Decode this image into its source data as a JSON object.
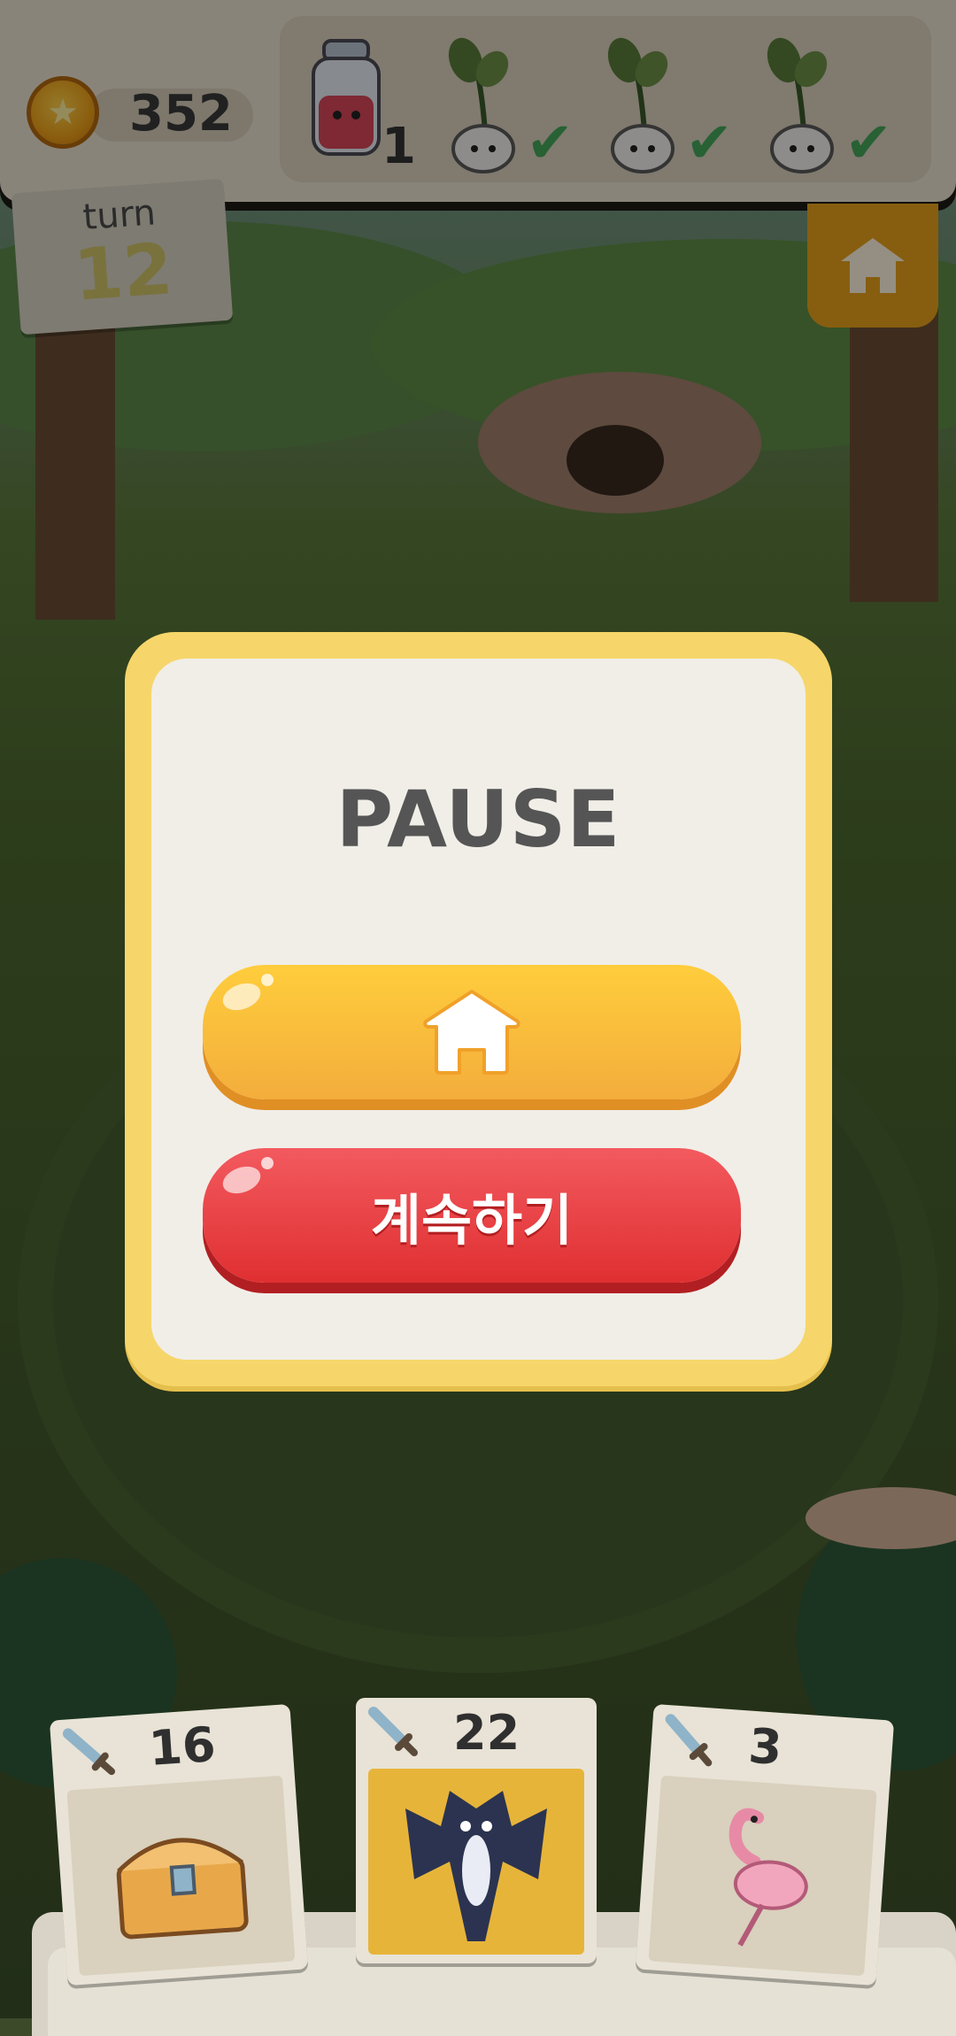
{
  "hud": {
    "coins": "352",
    "goals": [
      {
        "icon": "potion-jar-icon",
        "count": "1",
        "completed": false
      },
      {
        "icon": "sprout-radish-icon",
        "completed": true
      },
      {
        "icon": "sprout-radish-icon",
        "completed": true
      },
      {
        "icon": "sprout-radish-icon",
        "completed": true
      }
    ],
    "turn_label": "turn",
    "turn_number": "12"
  },
  "pause_menu": {
    "title": "PAUSE",
    "home_button_icon": "house-icon",
    "continue_label": "계속하기"
  },
  "hand_cards": [
    {
      "attack": "16",
      "art": "treasure-chest-icon"
    },
    {
      "attack": "22",
      "art": "bat-icon"
    },
    {
      "attack": "3",
      "art": "flamingo-icon"
    }
  ],
  "colors": {
    "modal_frame": "#f6d66a",
    "modal_body": "#f1eee8",
    "home_button": "#f3ad3c",
    "continue_button": "#e02f31",
    "check": "#46a85a"
  }
}
